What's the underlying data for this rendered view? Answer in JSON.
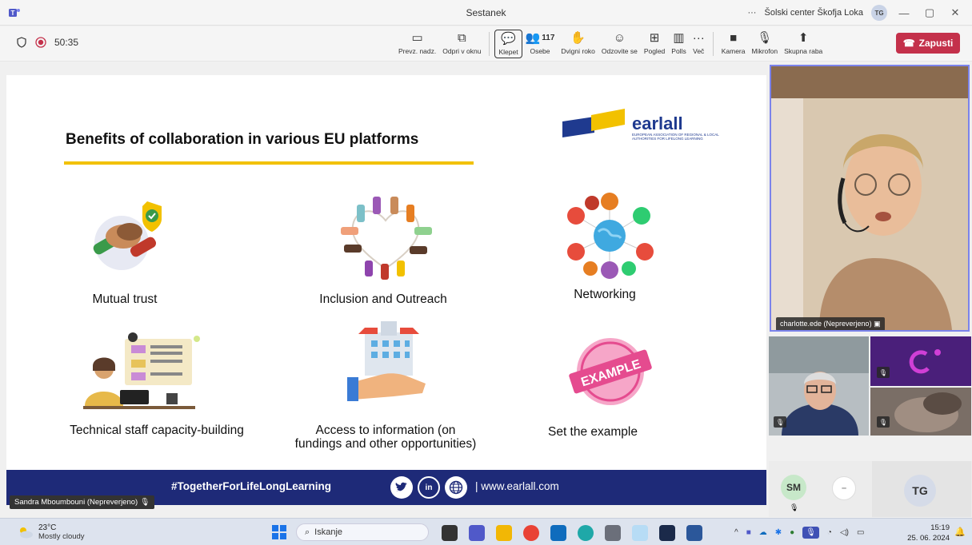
{
  "window": {
    "title": "Sestanek",
    "org": "Šolski center Škofja Loka",
    "user_initials": "TG",
    "more": "···",
    "minimize": "—",
    "restore": "▢",
    "close": "✕"
  },
  "toolbar": {
    "timer": "50:35",
    "tools": [
      {
        "icon": "share-screen-icon",
        "glyph": "▭",
        "label": "Prevz. nadz."
      },
      {
        "icon": "popout-icon",
        "glyph": "⧉",
        "label": "Odpri v oknu"
      },
      {
        "icon": "chat-icon",
        "glyph": "💬",
        "label": "Klepet"
      },
      {
        "icon": "people-icon",
        "glyph": "👥",
        "label": "Osebe",
        "count": "117"
      },
      {
        "icon": "raise-hand-icon",
        "glyph": "✋",
        "label": "Dvigni roko"
      },
      {
        "icon": "react-icon",
        "glyph": "☺",
        "label": "Odzovite se"
      },
      {
        "icon": "view-icon",
        "glyph": "⊞",
        "label": "Pogled"
      },
      {
        "icon": "polls-icon",
        "glyph": "▥",
        "label": "Polls"
      },
      {
        "icon": "more-icon",
        "glyph": "···",
        "label": "Več"
      }
    ],
    "media": [
      {
        "icon": "camera-off-icon",
        "glyph": "■",
        "label": "Kamera"
      },
      {
        "icon": "mic-off-icon",
        "glyph": "🎙",
        "label": "Mikrofon"
      },
      {
        "icon": "share-icon",
        "glyph": "⬆",
        "label": "Skupna raba"
      }
    ],
    "leave_label": "Zapusti"
  },
  "slide": {
    "title": "Benefits of collaboration in various EU platforms",
    "logo_name": "earlall",
    "logo_sub": "EUROPEAN ASSOCIATION OF REGIONAL & LOCAL AUTHORITIES FOR LIFELONG LEARNING",
    "benefits": [
      "Mutual trust",
      "Inclusion and Outreach",
      "Networking",
      "Technical staff capacity-building",
      "Access to information (on fundings and other opportunities)",
      "Set the example"
    ],
    "example_stamp": "EXAMPLE",
    "hashtag": "#TogetherForLifeLongLearning",
    "url": "| www.earlall.com",
    "social": [
      "twitter-icon",
      "linkedin-icon",
      "web-icon"
    ],
    "linkedin_text": "in"
  },
  "presenter_name": "Sandra Mboumbouni (Nepreverjeno)",
  "participants": {
    "main_name": "charlotte.ede (Nepreverjeno)",
    "avatar1": "SM",
    "avatar2": "–",
    "avatar3": "TG"
  },
  "taskbar": {
    "temp": "23°C",
    "weather": "Mostly cloudy",
    "search_placeholder": "Iskanje",
    "time": "15:19",
    "date": "25. 06. 2024"
  },
  "colors": {
    "accent": "#7b83eb",
    "leave": "#c4314b",
    "footer": "#1e2a78",
    "underline": "#f2c100",
    "logo_blue": "#1f3a8f"
  }
}
